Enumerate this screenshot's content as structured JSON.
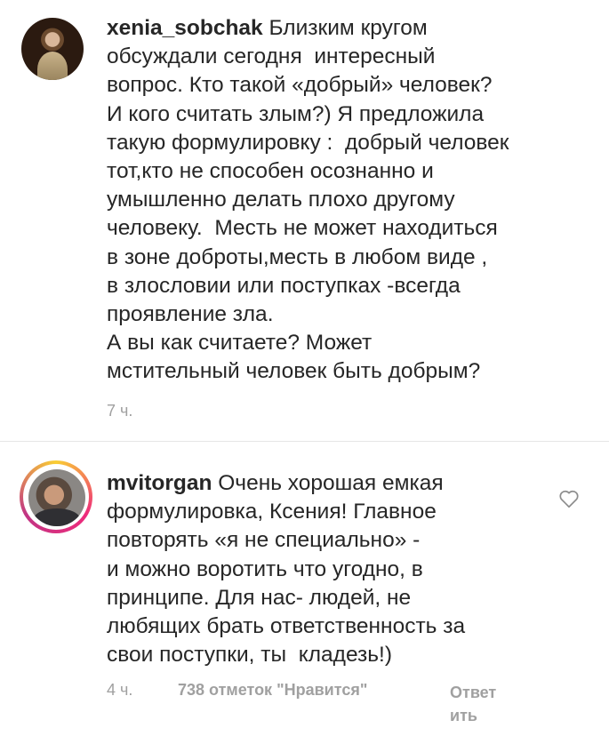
{
  "comments": [
    {
      "username": "xenia_sobchak",
      "lines": [
        "Близким кругом",
        "обсуждали сегодня  интересный",
        "вопрос. Кто такой «добрый» человек?",
        "И кого считать злым?) Я предложила",
        "такую формулировку :  добрый человек",
        "тот,кто не способен осознанно и",
        "умышленно делать плохо другому",
        "человеку.  Месть не может находиться",
        "в зоне доброты,месть в любом виде ,",
        "в злословии или поступках -всегда",
        "проявление зла.",
        "А вы как считаете? Может",
        "мстительный человек быть добрым?"
      ],
      "time": "7 ч."
    },
    {
      "username": "mvitorgan",
      "lines": [
        "Очень хорошая емкая",
        "формулировка, Ксения! Главное",
        "повторять «я не специально» -",
        "и можно воротить что угодно, в",
        "принципе. Для нас- людей, не",
        "любящих брать ответственность за",
        "свои поступки, ты  кладезь!)"
      ],
      "time": "4 ч.",
      "likes": "738 отметок \"Нравится\"",
      "reply_line1": "Ответ",
      "reply_line2": "ить",
      "like_icon": "heart-outline-icon"
    }
  ],
  "colors": {
    "text": "#262626",
    "meta": "#a0a0a0",
    "divider": "#e6e6e6",
    "story_ring": [
      "#f9ce34",
      "#ee2a7b",
      "#c13584"
    ]
  }
}
